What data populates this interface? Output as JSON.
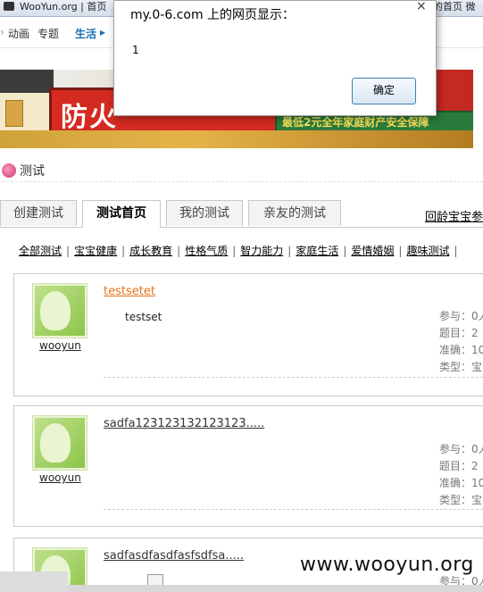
{
  "browser": {
    "tab_title": "WooYun.org | 首页",
    "tab_right": "的首页 微"
  },
  "site_nav": {
    "items": [
      "动画",
      "专题",
      "生活"
    ]
  },
  "banner": {
    "title": "防火",
    "subtitle": "最低2元全年家庭财产安全保障"
  },
  "heading": "测试",
  "tabs": [
    {
      "label": "创建测试",
      "active": false
    },
    {
      "label": "测试首页",
      "active": true
    },
    {
      "label": "我的测试",
      "active": false
    },
    {
      "label": "亲友的测试",
      "active": false
    }
  ],
  "tab_link": "回龄宝宝参",
  "categories": [
    "全部测试",
    "宝宝健康",
    "成长教育",
    "性格气质",
    "智力能力",
    "家庭生活",
    "爱情婚姻",
    "趣味测试"
  ],
  "cards": [
    {
      "user": "wooyun",
      "title": "testsetet",
      "desc": "testset",
      "meta": [
        "参与：0人",
        "题目：2",
        "准确：10",
        "类型：宝"
      ]
    },
    {
      "user": "wooyun",
      "title": "sadfa123123132123123.....",
      "desc": "",
      "meta": [
        "参与：0人",
        "题目：2",
        "准确：10",
        "类型：宝"
      ]
    },
    {
      "user": "",
      "title": "sadfasdfasdfasfsdfsa.....",
      "desc": "",
      "meta": [
        "参与：0人"
      ]
    }
  ],
  "dialog": {
    "title": "my.0-6.com 上的网页显示：",
    "message": "1",
    "ok_label": "确定",
    "close_glyph": "×"
  },
  "watermark": "www.wooyun.org"
}
